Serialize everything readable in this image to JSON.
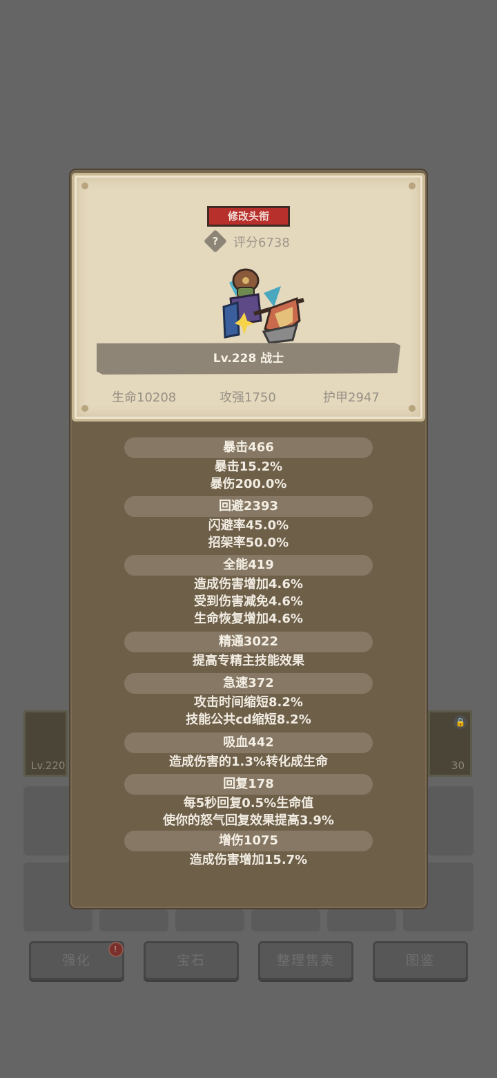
{
  "background": {
    "slot_left_level": "Lv.220",
    "slot_right_level": "30",
    "buttons": [
      "强化",
      "宝石",
      "整理售卖",
      "图鉴"
    ],
    "alert_badge": "!"
  },
  "card": {
    "title_button": "修改头衔",
    "score_help_icon": "?",
    "score": "评分6738",
    "name": "Lv.228 战士",
    "hp": "生命10208",
    "attack": "攻强1750",
    "armor": "护甲2947"
  },
  "stats": {
    "crit": {
      "title": "暴击466",
      "lines": [
        "暴击15.2%",
        "暴伤200.0%"
      ]
    },
    "dodge": {
      "title": "回避2393",
      "lines": [
        "闪避率45.0%",
        "招架率50.0%"
      ]
    },
    "versatility": {
      "title": "全能419",
      "lines": [
        "造成伤害增加4.6%",
        "受到伤害减免4.6%",
        "生命恢复增加4.6%"
      ]
    },
    "mastery": {
      "title": "精通3022",
      "lines": [
        "提高专精主技能效果"
      ]
    },
    "haste": {
      "title": "急速372",
      "lines": [
        "攻击时间缩短8.2%",
        "技能公共cd缩短8.2%"
      ]
    },
    "leech": {
      "title": "吸血442",
      "lines": [
        "造成伤害的1.3%转化成生命"
      ]
    },
    "regen": {
      "title": "回复178",
      "lines": [
        "每5秒回复0.5%生命值",
        "使你的怒气回复效果提高3.9%"
      ]
    },
    "damage": {
      "title": "增伤1075",
      "lines": [
        "造成伤害增加15.7%"
      ]
    }
  }
}
